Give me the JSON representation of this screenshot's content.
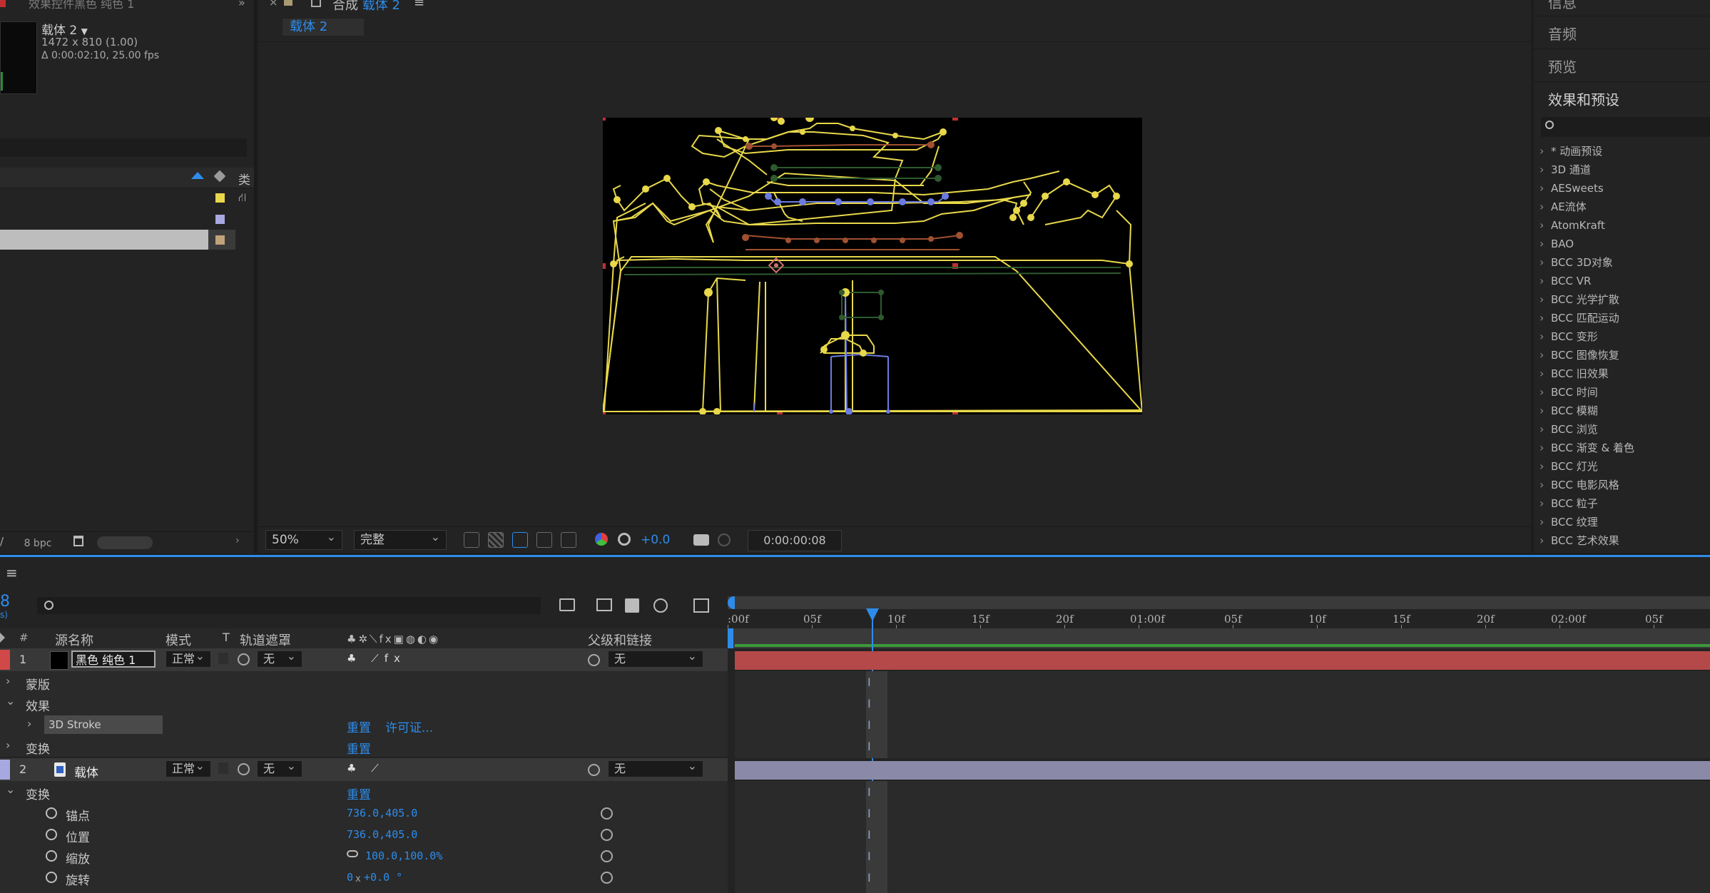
{
  "project_panel": {
    "header_title": "效果控件黑色 纯色 1",
    "item_name": "载体 2",
    "item_dims": "1472 x 810 (1.00)",
    "item_duration": "Δ 0:00:02:10, 25.00 fps",
    "col_type": "类",
    "bpc": "8 bpc",
    "swatch_colors": [
      "#e8d84a",
      "#a8a8e0",
      "#c2a27a"
    ]
  },
  "comp_panel": {
    "tab_close": "×",
    "tab_label": "合成",
    "tab_name": "载体 2",
    "tab_menu": "≡",
    "sub_tab": "载体 2",
    "zoom": "50%",
    "resolution": "完整",
    "exposure": "+0.0",
    "timecode": "0:00:00:08"
  },
  "right_panel": {
    "items": [
      "信息",
      "音频",
      "预览",
      "效果和预设"
    ],
    "effects": [
      "* 动画预设",
      "3D 通道",
      "AESweets",
      "AE流体",
      "AtomKraft",
      "BAO",
      "BCC 3D对象",
      "BCC VR",
      "BCC 光学扩散",
      "BCC 匹配运动",
      "BCC 变形",
      "BCC 图像恢复",
      "BCC 旧效果",
      "BCC 时间",
      "BCC 模糊",
      "BCC 浏览",
      "BCC 渐变 & 着色",
      "BCC 灯光",
      "BCC 电影风格",
      "BCC 粒子",
      "BCC 纹理",
      "BCC 艺术效果"
    ]
  },
  "timeline": {
    "menu": "≡",
    "frame_fragment": "8",
    "frame_fragment2": "s)",
    "col_hash": "#",
    "col_source": "源名称",
    "col_mode": "模式",
    "col_t": "T",
    "col_matte": "轨道遮罩",
    "col_parent": "父级和链接",
    "ruler": [
      ":00f",
      "05f",
      "10f",
      "15f",
      "20f",
      "01:00f",
      "05f",
      "10f",
      "15f",
      "20f",
      "02:00f",
      "05f"
    ],
    "layers": [
      {
        "num": "1",
        "name": "黑色 纯色 1",
        "mode": "正常",
        "matte": "无",
        "parent": "无",
        "color": "#d04848"
      },
      {
        "num": "2",
        "name": "载体",
        "mode": "正常",
        "matte": "无",
        "parent": "无",
        "color": "#a8a8e0"
      }
    ],
    "props": {
      "masks": "蒙版",
      "effects": "效果",
      "effect_name": "3D Stroke",
      "reset": "重置",
      "license": "许可证...",
      "transform": "变换",
      "anchor": "锚点",
      "anchor_val": "736.0,405.0",
      "position": "位置",
      "position_val": "736.0,405.0",
      "scale": "缩放",
      "scale_val": "100.0,100.0%",
      "rotation": "旋转",
      "rotation_val_a": "0",
      "rotation_val_x": "x",
      "rotation_val_b": "+0.0 °"
    }
  }
}
